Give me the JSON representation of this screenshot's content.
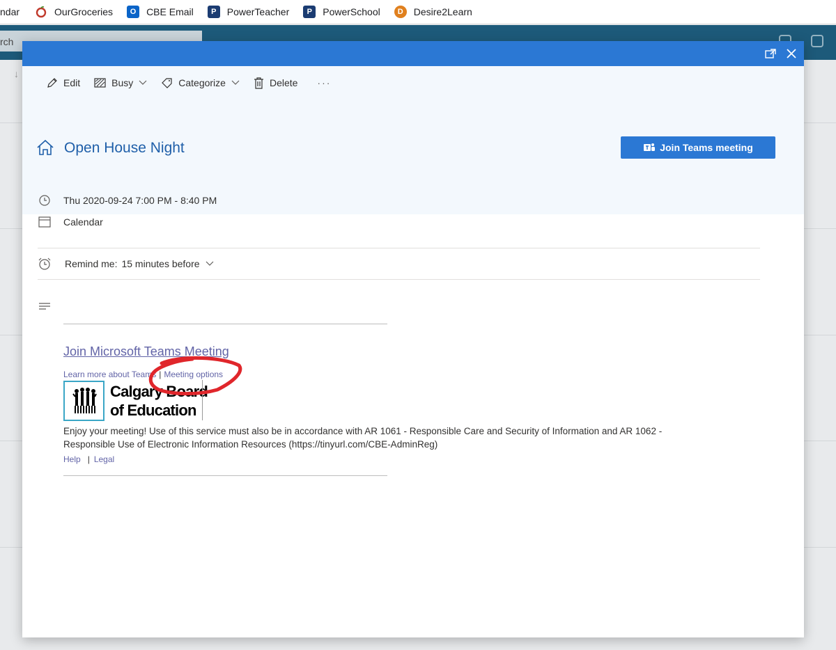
{
  "bookmarks": [
    {
      "label": "ndar",
      "icon": "none"
    },
    {
      "label": "OurGroceries",
      "icon": "apple-icon"
    },
    {
      "label": "CBE Email",
      "icon": "outlook-icon"
    },
    {
      "label": "PowerTeacher",
      "icon": "powerschool-icon"
    },
    {
      "label": "PowerSchool",
      "icon": "powerschool-icon"
    },
    {
      "label": "Desire2Learn",
      "icon": "d2l-icon"
    }
  ],
  "background": {
    "search_text": "rch"
  },
  "toolbar": {
    "edit": "Edit",
    "busy": "Busy",
    "categorize": "Categorize",
    "delete": "Delete",
    "more": "···"
  },
  "event": {
    "title": "Open House Night",
    "join_button": "Join Teams meeting",
    "datetime": "Thu 2020-09-24 7:00 PM - 8:40 PM",
    "calendar": "Calendar",
    "remind_label": "Remind me:",
    "remind_value": "15 minutes before"
  },
  "body": {
    "teams_link": "Join Microsoft Teams Meeting",
    "learn_more": "Learn more about Teams",
    "pipe": "|",
    "meeting_options": "Meeting options",
    "logo_line1": "Calgary Board",
    "logo_line2": "of Education",
    "notice": "Enjoy your meeting! Use of this service must also be in accordance with AR 1061 - Responsible Care and Security of Information and AR 1062 - Responsible Use of Electronic Information Resources (https://tinyurl.com/CBE-AdminReg)",
    "help": "Help",
    "legal": "Legal"
  },
  "colors": {
    "accent": "#2b78d4",
    "title": "#1f5fa9",
    "link": "#6264a7",
    "annotation": "#e0262b"
  }
}
